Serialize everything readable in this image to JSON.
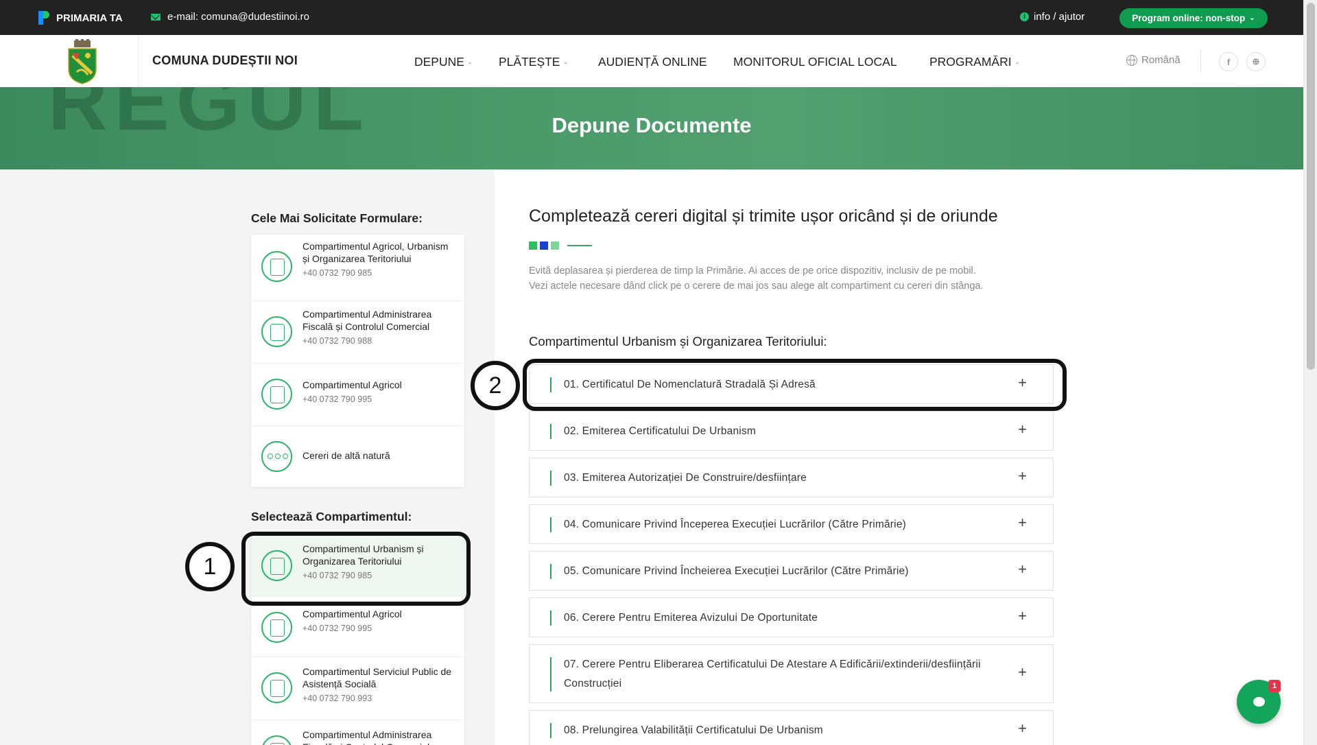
{
  "topbar": {
    "brand": "PRIMARIA TA",
    "email": "e-mail: comuna@dudestiinoi.ro",
    "info": "info / ajutor",
    "program_button": "Program online: non-stop"
  },
  "header": {
    "site_name": "COMUNA DUDEȘTII NOI",
    "nav": [
      {
        "label": "DEPUNE",
        "dropdown": true
      },
      {
        "label": "PLĂTEȘTE",
        "dropdown": true
      },
      {
        "label": "AUDIENȚĂ ONLINE",
        "dropdown": false
      },
      {
        "label": "MONITORUL OFICIAL LOCAL",
        "dropdown": false
      },
      {
        "label": "PROGRAMĂRI",
        "dropdown": true
      }
    ],
    "language": "Română",
    "social": [
      "f",
      "⊕"
    ]
  },
  "hero": {
    "title": "Depune Documente",
    "ghost": "REGUL"
  },
  "sidebar": {
    "popular_title": "Cele Mai Solicitate Formulare:",
    "popular": [
      {
        "name": "Compartimentul Agricol, Urbanism și Organizarea Teritoriului",
        "phone": "+40 0732 790 985"
      },
      {
        "name": "Compartimentul Administrarea Fiscală și Controlul Comercial",
        "phone": "+40 0732 790 988"
      },
      {
        "name": "Compartimentul Agricol",
        "phone": "+40 0732 790 995"
      },
      {
        "name": "Cereri de altă natură",
        "phone": ""
      }
    ],
    "select_title": "Selectează Compartimentul:",
    "departments": [
      {
        "name": "Compartimentul Urbanism și Organizarea Teritoriului",
        "phone": "+40 0732 790 985"
      },
      {
        "name": "Compartimentul Agricol",
        "phone": "+40 0732 790 995"
      },
      {
        "name": "Compartimentul Serviciul Public de Asistență Socială",
        "phone": "+40 0732 790 993"
      },
      {
        "name": "Compartimentul Administrarea Fiscală și Controlul Comercial –",
        "phone": ""
      }
    ]
  },
  "main": {
    "title": "Completează cereri digital și trimite ușor oricând și de oriunde",
    "description_1": "Evită deplasarea și pierderea de timp la Primărie. Ai acces de pe orice dispozitiv, inclusiv de pe mobil.",
    "description_2": "Vezi actele necesare dând click pe o cerere de mai jos sau alege alt compartiment cu cereri din stânga.",
    "section_title": "Compartimentul Urbanism și Organizarea Teritoriului:",
    "requests": [
      "01. Certificatul De Nomenclatură Stradală Și Adresă",
      "02. Emiterea Certificatului De Urbanism",
      "03. Emiterea Autorizației De Construire/desființare",
      "04. Comunicare Privind Începerea Execuției Lucrărilor (Către Primărie)",
      "05. Comunicare Privind Încheierea Execuției Lucrărilor (Către Primărie)",
      "06. Cerere Pentru Emiterea Avizului De Oportunitate",
      "07. Cerere Pentru Eliberarea Certificatului De Atestare A Edificării/extinderii/desființării Construcției",
      "08. Prelungirea Valabilității Certificatului De Urbanism"
    ],
    "expand_symbol": "+"
  },
  "annotations": [
    "1",
    "2"
  ],
  "chat": {
    "badge": "1"
  },
  "colors": {
    "accent": "#0f9c4f",
    "topbar": "#222222",
    "hero": "#4a9a6a",
    "deco_1": "#2cc05e",
    "deco_2": "#1a3fd6",
    "deco_3": "#7fd69b"
  }
}
